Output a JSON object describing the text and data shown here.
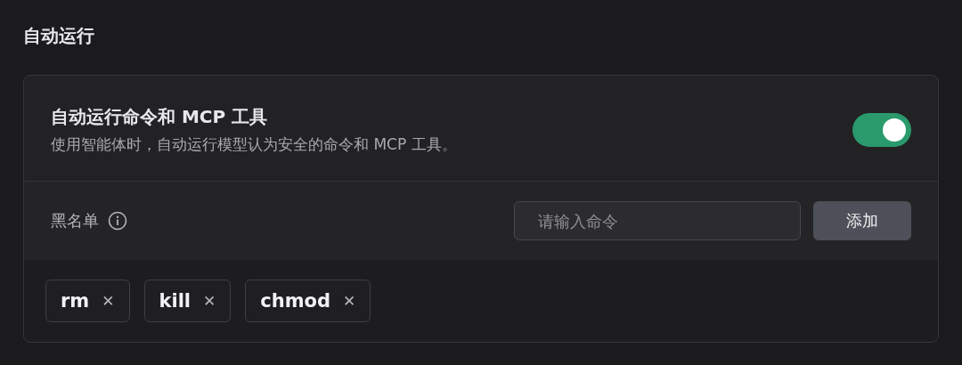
{
  "section_title": "自动运行",
  "setting": {
    "title": "自动运行命令和 MCP 工具",
    "description": "使用智能体时，自动运行模型认为安全的命令和 MCP 工具。",
    "on": true
  },
  "blacklist": {
    "label": "黑名单",
    "input": {
      "placeholder": "请输入命令"
    },
    "add_button": "添加",
    "tags": [
      {
        "label": "rm",
        "remove": "✕"
      },
      {
        "label": "kill",
        "remove": "✕"
      },
      {
        "label": "chmod",
        "remove": "✕"
      }
    ]
  }
}
